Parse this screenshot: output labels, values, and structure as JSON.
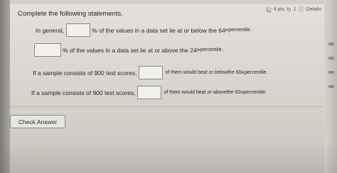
{
  "header": {
    "points": "4 pts",
    "retry": "1",
    "details": "Details"
  },
  "question": {
    "heading": "Complete the following statements.",
    "line1": {
      "prefix": "In general,",
      "suffix": "% of the values in a data set lie at or below the 64",
      "sup": "th",
      "end": " percentile."
    },
    "line2": {
      "suffix": "% of the values in a data set lie at or above the 24",
      "sup": "th",
      "end": " percentile.."
    },
    "line3": {
      "prefix": "If a sample consists of 900 test scores,",
      "suffix_a": "of them would be ",
      "em": "at or below",
      "suffix_b": " the 60",
      "sup": "th",
      "end": " percentile."
    },
    "line4": {
      "prefix": "If a sample consists of 900 test scores,",
      "suffix_a": "of them would be ",
      "em": "at or above",
      "suffix_b": " the 62",
      "sup": "th",
      "end": " percentile."
    }
  },
  "footer": {
    "check_answer": "Check Answer"
  }
}
